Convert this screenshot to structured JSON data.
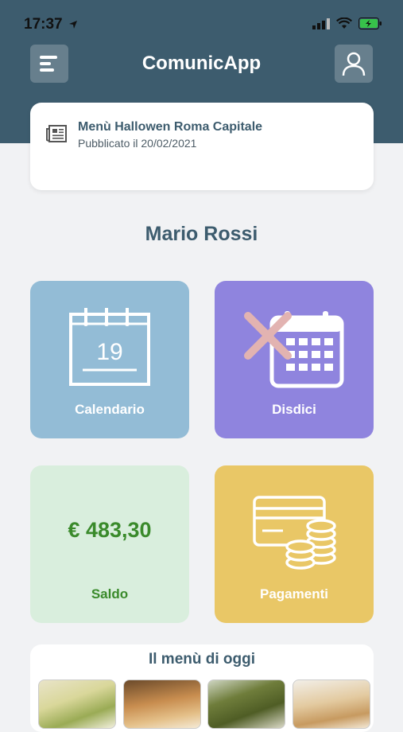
{
  "status_bar": {
    "time": "17:37"
  },
  "header": {
    "title": "ComunicApp",
    "menu_icon": "menu-icon",
    "profile_icon": "user-icon"
  },
  "news": {
    "title": "Menù Hallowen Roma Capitale",
    "date": "Pubblicato il 20/02/2021",
    "icon": "newspaper-icon"
  },
  "user": {
    "name": "Mario Rossi"
  },
  "tiles": {
    "calendar": {
      "label": "Calendario",
      "day": "19",
      "color": "#93bcd6"
    },
    "cancel": {
      "label": "Disdici",
      "color": "#8f84de"
    },
    "balance": {
      "label": "Saldo",
      "amount": "€ 483,30",
      "color": "#d9eedd",
      "text_color": "#3a8a2b"
    },
    "payments": {
      "label": "Pagamenti",
      "color": "#e9c766"
    }
  },
  "menu": {
    "title": "Il menù di oggi"
  }
}
